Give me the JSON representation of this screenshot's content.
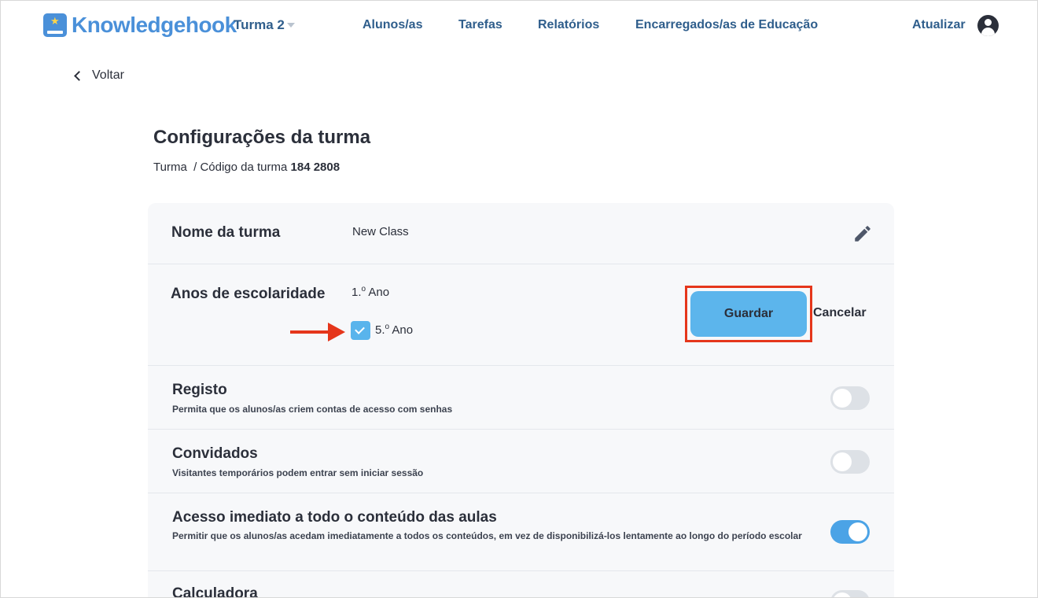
{
  "header": {
    "brand": "Knowledgehook",
    "class_selector": "Turma 2",
    "nav": [
      "Alunos/as",
      "Tarefas",
      "Relatórios",
      "Encarregados/as de Educação"
    ],
    "refresh": "Atualizar"
  },
  "back": "Voltar",
  "page": {
    "title": "Configurações da turma",
    "crumb_prefix": "Turma  / Código da turma ",
    "class_code": "184 2808"
  },
  "settings": {
    "class_name": {
      "label": "Nome da turma",
      "value": "New Class"
    },
    "grades": {
      "label": "Anos de escolaridade",
      "options": [
        {
          "num": "1.",
          "sup": "o",
          "rest": " Ano",
          "checked": false
        },
        {
          "num": "5.",
          "sup": "o",
          "rest": " Ano",
          "checked": true
        }
      ],
      "save": "Guardar",
      "cancel": "Cancelar"
    },
    "registration": {
      "label": "Registo",
      "desc": "Permita que os alunos/as criem contas de acesso com senhas",
      "enabled": false
    },
    "guests": {
      "label": "Convidados",
      "desc": "Visitantes temporários podem entrar sem iniciar sessão",
      "enabled": false
    },
    "immediate_access": {
      "label": "Acesso imediato a todo o conteúdo das aulas",
      "desc": "Permitir que os alunos/as acedam imediatamente a todos os conteúdos, em vez de disponibilizá-los lentamente ao longo do período escolar",
      "enabled": true
    },
    "calculator": {
      "label": "Calculadora",
      "enabled": false
    }
  },
  "colors": {
    "brand": "#4a90d9",
    "nav_text": "#2f5e8c",
    "save_button": "#5cb5ec",
    "highlight": "#e5361b",
    "toggle_on": "#4ba3e6",
    "toggle_off": "#dde1e6"
  }
}
